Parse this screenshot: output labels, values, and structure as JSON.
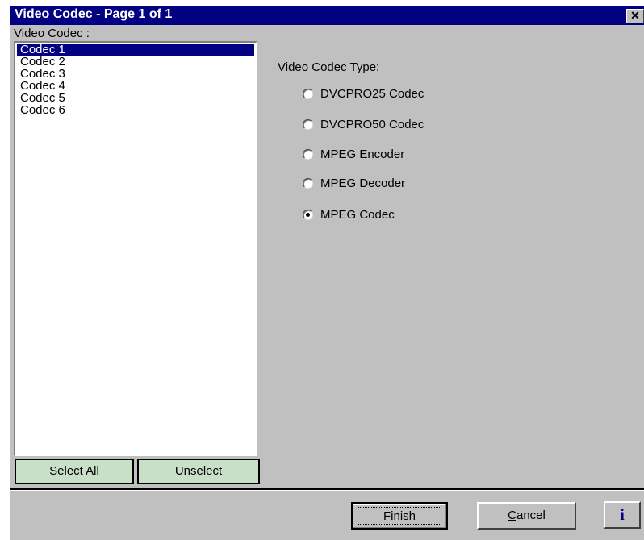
{
  "window": {
    "title": "Video Codec - Page 1 of 1",
    "close_label": "✕"
  },
  "codec_list": {
    "label": "Video Codec :",
    "items": [
      "Codec 1",
      "Codec 2",
      "Codec 3",
      "Codec 4",
      "Codec 5",
      "Codec 6"
    ],
    "selected": "Codec 1"
  },
  "list_buttons": {
    "select_all": "Select All",
    "unselect": "Unselect"
  },
  "codec_type": {
    "label": "Video Codec Type:",
    "options": [
      "DVCPRO25 Codec",
      "DVCPRO50 Codec",
      "MPEG Encoder",
      "MPEG Decoder",
      "MPEG Codec"
    ],
    "selected": "MPEG Codec"
  },
  "footer": {
    "finish_mnemonic": "F",
    "finish_rest": "inish",
    "cancel_mnemonic": "C",
    "cancel_rest": "ancel",
    "info_label": "i"
  },
  "colors": {
    "titlebar": "#000080",
    "selection": "#000080",
    "green_button": "#c8e0c8",
    "face": "#c0c0c0"
  }
}
